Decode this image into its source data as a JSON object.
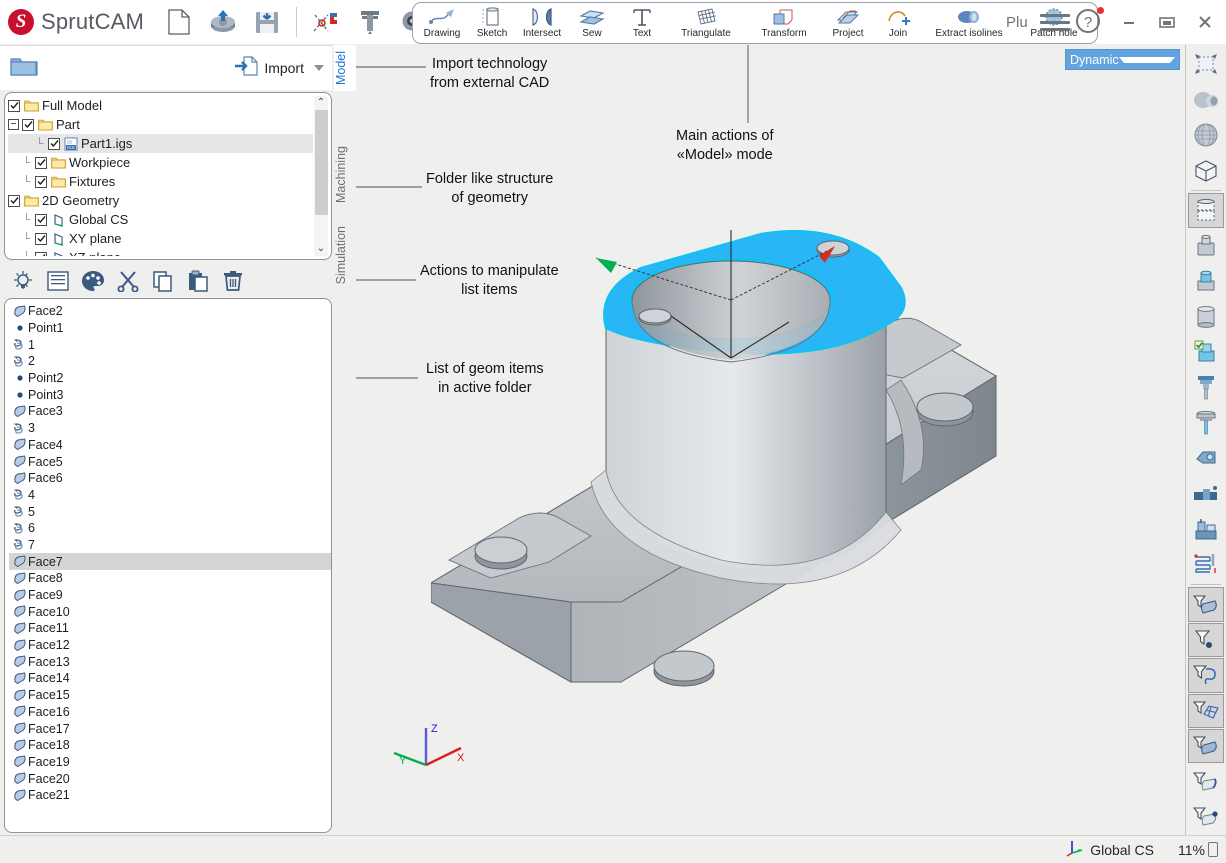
{
  "app": {
    "brand": "SprutCAM",
    "brand_mark": "S",
    "brand_color": "#c8102e"
  },
  "header": {
    "file_icons": [
      {
        "name": "new-document-icon",
        "label": "New"
      },
      {
        "name": "open-file-icon",
        "label": "Open"
      },
      {
        "name": "save-file-icon",
        "label": "Save"
      }
    ],
    "tool_icons": [
      {
        "name": "snap-magnet-icon",
        "label": "Snap"
      },
      {
        "name": "caliper-icon",
        "label": "Caliper"
      },
      {
        "name": "measure-tape-icon",
        "label": "Measure"
      }
    ],
    "actions": [
      {
        "name": "drawing",
        "label": "Drawing"
      },
      {
        "name": "sketch",
        "label": "Sketch"
      },
      {
        "name": "intersect",
        "label": "Intersect"
      },
      {
        "name": "sew",
        "label": "Sew"
      },
      {
        "name": "text",
        "label": "Text"
      },
      {
        "name": "triangulate",
        "label": "Triangulate"
      },
      {
        "name": "transform",
        "label": "Transform"
      },
      {
        "name": "project",
        "label": "Project"
      },
      {
        "name": "join",
        "label": "Join"
      },
      {
        "name": "extract-isolines",
        "label": "Extract isolines"
      },
      {
        "name": "patch-hole",
        "label": "Patch hole"
      }
    ],
    "plugins_label": "Plu",
    "help_has_notification": true,
    "window_buttons": [
      {
        "name": "minimize",
        "glyph": "—"
      },
      {
        "name": "restore",
        "glyph": "❐"
      },
      {
        "name": "close",
        "glyph": "✕"
      }
    ]
  },
  "left_panel": {
    "folder_button": "folder-icon",
    "import_label": "Import",
    "tree": [
      {
        "label": "Full Model",
        "depth": 0,
        "checked": true,
        "icon": "folder",
        "expander": "none",
        "elbow": false,
        "selected": false
      },
      {
        "label": "Part",
        "depth": 0,
        "checked": true,
        "icon": "folder",
        "expander": "minus",
        "elbow": false,
        "selected": false
      },
      {
        "label": "Part1.igs",
        "depth": 2,
        "checked": true,
        "icon": "igs",
        "expander": "none",
        "elbow": true,
        "selected": true
      },
      {
        "label": "Workpiece",
        "depth": 1,
        "checked": true,
        "icon": "folder",
        "expander": "none",
        "elbow": true,
        "selected": false
      },
      {
        "label": "Fixtures",
        "depth": 1,
        "checked": true,
        "icon": "folder",
        "expander": "none",
        "elbow": true,
        "selected": false
      },
      {
        "label": "2D Geometry",
        "depth": 0,
        "checked": true,
        "icon": "folder",
        "expander": "none",
        "elbow": false,
        "selected": false
      },
      {
        "label": "Global CS",
        "depth": 1,
        "checked": true,
        "icon": "cs",
        "expander": "none",
        "elbow": true,
        "selected": false
      },
      {
        "label": "XY plane",
        "depth": 1,
        "checked": true,
        "icon": "cs",
        "expander": "none",
        "elbow": true,
        "selected": false
      },
      {
        "label": "XZ plane",
        "depth": 1,
        "checked": true,
        "icon": "cs",
        "expander": "none",
        "elbow": true,
        "selected": false
      }
    ],
    "list_toolbar": [
      {
        "name": "visibility-bulb-icon",
        "label": "Show/hide"
      },
      {
        "name": "properties-list-icon",
        "label": "Properties"
      },
      {
        "name": "color-palette-icon",
        "label": "Color"
      },
      {
        "name": "cut-scissors-icon",
        "label": "Cut"
      },
      {
        "name": "copy-icon",
        "label": "Copy"
      },
      {
        "name": "paste-icon",
        "label": "Paste"
      },
      {
        "name": "delete-trash-icon",
        "label": "Delete"
      }
    ],
    "geom_list": [
      {
        "label": "Face2",
        "icon": "face",
        "selected": false
      },
      {
        "label": "Point1",
        "icon": "point",
        "selected": false
      },
      {
        "label": "1",
        "icon": "curve",
        "selected": false
      },
      {
        "label": "2",
        "icon": "curve",
        "selected": false
      },
      {
        "label": "Point2",
        "icon": "point",
        "selected": false
      },
      {
        "label": "Point3",
        "icon": "point",
        "selected": false
      },
      {
        "label": "Face3",
        "icon": "face",
        "selected": false
      },
      {
        "label": "3",
        "icon": "curve",
        "selected": false
      },
      {
        "label": "Face4",
        "icon": "face",
        "selected": false
      },
      {
        "label": "Face5",
        "icon": "face",
        "selected": false
      },
      {
        "label": "Face6",
        "icon": "face",
        "selected": false
      },
      {
        "label": "4",
        "icon": "curve",
        "selected": false
      },
      {
        "label": "5",
        "icon": "curve",
        "selected": false
      },
      {
        "label": "6",
        "icon": "curve",
        "selected": false
      },
      {
        "label": "7",
        "icon": "curve",
        "selected": false
      },
      {
        "label": "Face7",
        "icon": "face",
        "selected": true
      },
      {
        "label": "Face8",
        "icon": "face",
        "selected": false
      },
      {
        "label": "Face9",
        "icon": "face",
        "selected": false
      },
      {
        "label": "Face10",
        "icon": "face",
        "selected": false
      },
      {
        "label": "Face11",
        "icon": "face",
        "selected": false
      },
      {
        "label": "Face12",
        "icon": "face",
        "selected": false
      },
      {
        "label": "Face13",
        "icon": "face",
        "selected": false
      },
      {
        "label": "Face14",
        "icon": "face",
        "selected": false
      },
      {
        "label": "Face15",
        "icon": "face",
        "selected": false
      },
      {
        "label": "Face16",
        "icon": "face",
        "selected": false
      },
      {
        "label": "Face17",
        "icon": "face",
        "selected": false
      },
      {
        "label": "Face18",
        "icon": "face",
        "selected": false
      },
      {
        "label": "Face19",
        "icon": "face",
        "selected": false
      },
      {
        "label": "Face20",
        "icon": "face",
        "selected": false
      },
      {
        "label": "Face21",
        "icon": "face",
        "selected": false
      }
    ]
  },
  "mode_tabs": [
    {
      "label": "Model",
      "active": true
    },
    {
      "label": "Machining",
      "active": false
    },
    {
      "label": "Simulation",
      "active": false
    }
  ],
  "viewport": {
    "view_mode": "Dynamic",
    "axis": {
      "x": "X",
      "y": "Y",
      "z": "Z",
      "x_color": "#e01b1b",
      "y_color": "#00b050",
      "z_color": "#2222e0"
    },
    "highlight_color": "#29b6f6",
    "part_color": "#b9bcc0"
  },
  "callouts": [
    {
      "name": "callout-import",
      "text": "Import technology\nfrom external CAD"
    },
    {
      "name": "callout-main-actions",
      "text": "Main actions of\n«Model» mode"
    },
    {
      "name": "callout-folder",
      "text": "Folder like structure\nof geometry"
    },
    {
      "name": "callout-actions",
      "text": "Actions to manipulate\nlist items"
    },
    {
      "name": "callout-list",
      "text": "List of geom items\nin active folder"
    }
  ],
  "right_rail": [
    {
      "name": "fit-to-view-icon",
      "boxed": false
    },
    {
      "name": "shaded-solid-icon",
      "boxed": false
    },
    {
      "name": "wireframe-sphere-icon",
      "boxed": false
    },
    {
      "name": "box-wireframe-icon",
      "boxed": false
    },
    {
      "name": "part-stock-view-icon",
      "boxed": true
    },
    {
      "name": "stock-solid-icon",
      "boxed": false
    },
    {
      "name": "stock-blue-icon",
      "boxed": false
    },
    {
      "name": "cylinder-stock-icon",
      "boxed": false
    },
    {
      "name": "stock-checked-icon",
      "boxed": false
    },
    {
      "name": "tool-holder-icon",
      "boxed": false
    },
    {
      "name": "tool-mill-icon",
      "boxed": false
    },
    {
      "name": "machine-part-icon",
      "boxed": false
    },
    {
      "name": "vise-fixture-icon",
      "boxed": false
    },
    {
      "name": "machine-icon",
      "boxed": false
    },
    {
      "name": "toolpath-icon",
      "boxed": false
    },
    {
      "name": "filter-faces-icon",
      "boxed": true
    },
    {
      "name": "filter-points-icon",
      "boxed": true
    },
    {
      "name": "filter-curves-icon",
      "boxed": true
    },
    {
      "name": "filter-mesh-icon",
      "boxed": true
    },
    {
      "name": "filter-surface-icon",
      "boxed": true
    },
    {
      "name": "filter-edge-icon",
      "boxed": false
    },
    {
      "name": "filter-vertex-icon",
      "boxed": false
    }
  ],
  "status": {
    "cs_label": "Global CS",
    "zoom": "11%"
  }
}
